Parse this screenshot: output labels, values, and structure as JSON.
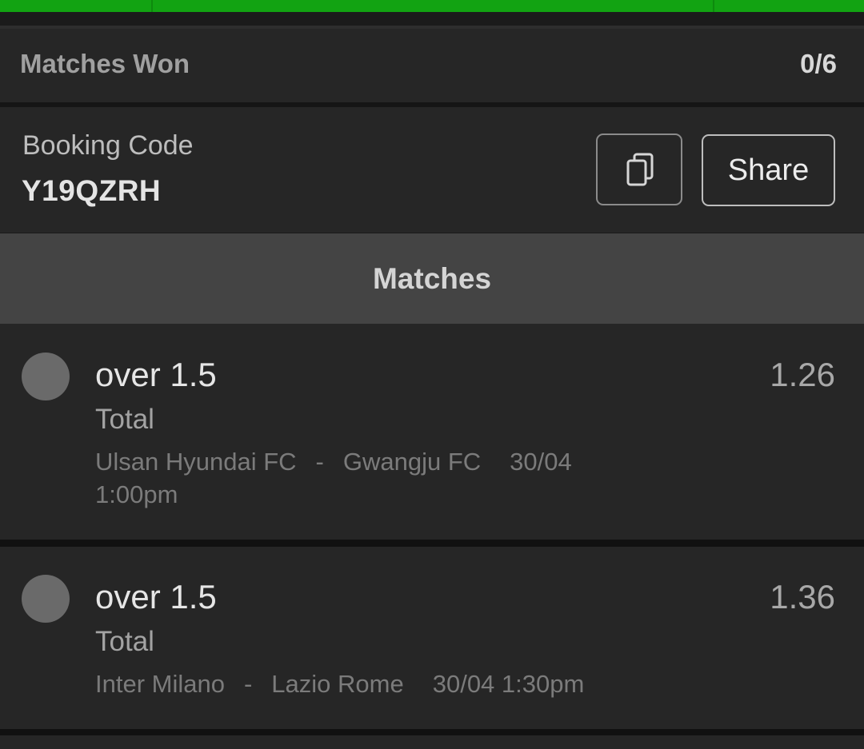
{
  "summary": {
    "won_label": "Matches Won",
    "won_value": "0/6"
  },
  "booking": {
    "label": "Booking Code",
    "code": "Y19QZRH",
    "copy_icon": "copy-icon",
    "share_label": "Share"
  },
  "matches_header": "Matches",
  "matches": [
    {
      "market": "over 1.5",
      "type": "Total",
      "odds": "1.26",
      "home": "Ulsan Hyundai FC",
      "separator": "-",
      "away": "Gwangju FC",
      "date": "30/04",
      "time": "1:00pm"
    },
    {
      "market": "over 1.5",
      "type": "Total",
      "odds": "1.36",
      "home": "Inter Milano",
      "separator": "-",
      "away": "Lazio Rome",
      "date": "30/04",
      "time": "1:30pm"
    }
  ],
  "colors": {
    "accent_green": "#12a312",
    "background": "#1b1b1b",
    "card": "#262626",
    "header": "#444444"
  }
}
